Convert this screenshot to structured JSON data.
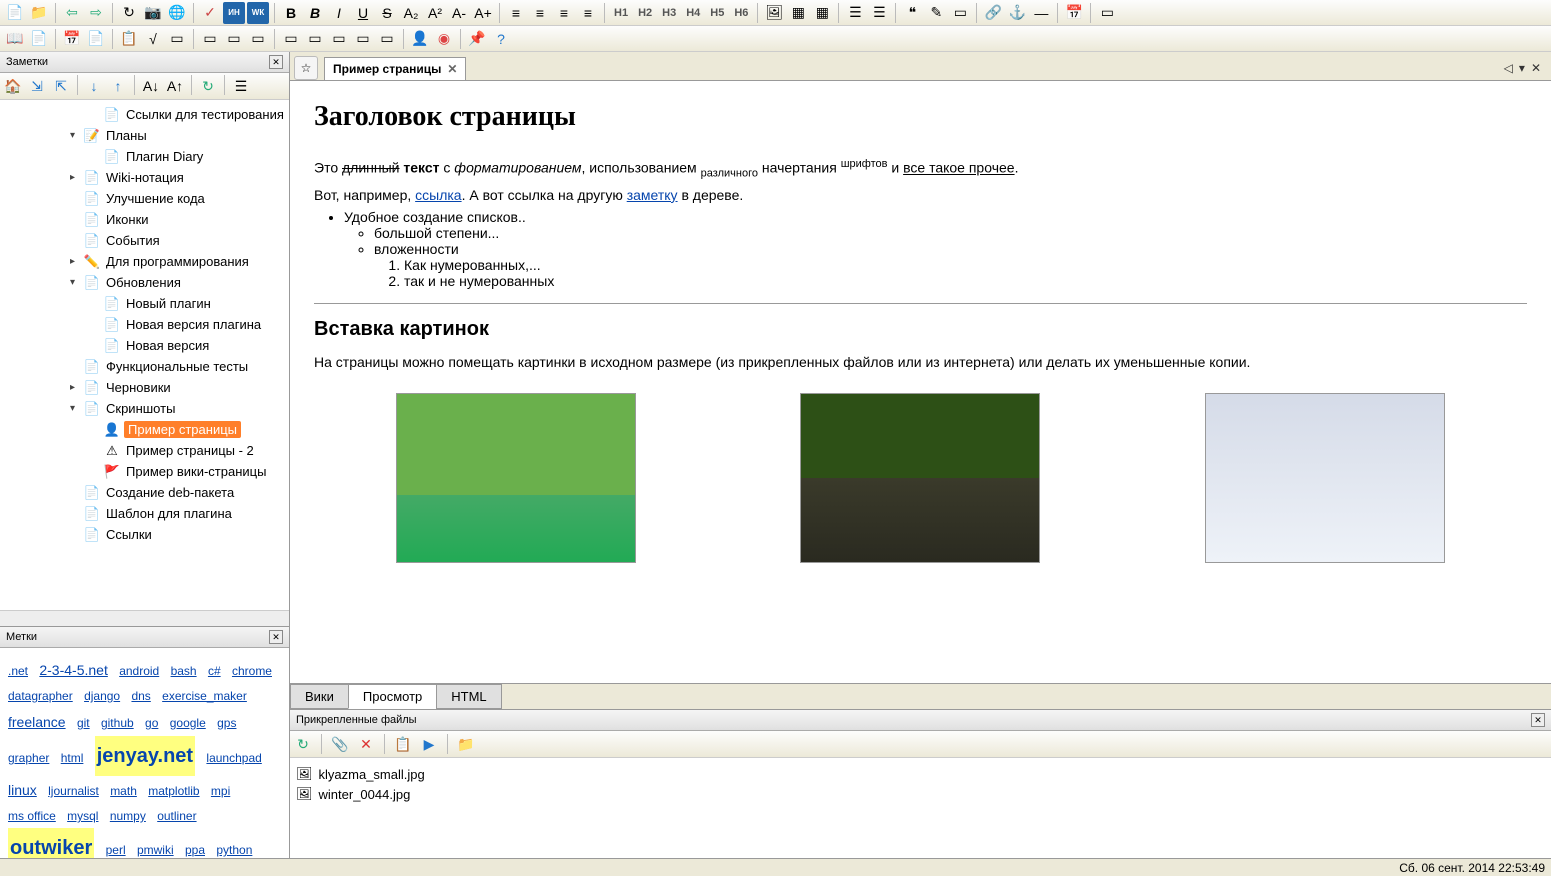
{
  "panels": {
    "notes_title": "Заметки",
    "tags_title": "Метки",
    "attach_title": "Прикрепленные файлы"
  },
  "tree": [
    {
      "label": "Ссылки для тестирования",
      "level": 2,
      "icon": "page"
    },
    {
      "label": "Планы",
      "level": 1,
      "icon": "page-edit",
      "expander": "▾"
    },
    {
      "label": "Плагин Diary",
      "level": 2,
      "icon": "page"
    },
    {
      "label": "Wiki-нотация",
      "level": 1,
      "icon": "page",
      "expander": "▸"
    },
    {
      "label": "Улучшение кода",
      "level": 1,
      "icon": "page"
    },
    {
      "label": "Иконки",
      "level": 1,
      "icon": "page"
    },
    {
      "label": "События",
      "level": 1,
      "icon": "page"
    },
    {
      "label": "Для программирования",
      "level": 1,
      "icon": "pencil",
      "expander": "▸"
    },
    {
      "label": "Обновления",
      "level": 1,
      "icon": "page",
      "expander": "▾"
    },
    {
      "label": "Новый плагин",
      "level": 2,
      "icon": "page"
    },
    {
      "label": "Новая версия плагина",
      "level": 2,
      "icon": "page"
    },
    {
      "label": "Новая версия",
      "level": 2,
      "icon": "page"
    },
    {
      "label": "Функциональные тесты",
      "level": 1,
      "icon": "page"
    },
    {
      "label": "Черновики",
      "level": 1,
      "icon": "page",
      "expander": "▸"
    },
    {
      "label": "Скриншоты",
      "level": 1,
      "icon": "page",
      "expander": "▾"
    },
    {
      "label": "Пример страницы",
      "level": 2,
      "icon": "user",
      "selected": true
    },
    {
      "label": "Пример страницы - 2",
      "level": 2,
      "icon": "warning"
    },
    {
      "label": "Пример вики-страницы",
      "level": 2,
      "icon": "flag"
    },
    {
      "label": "Создание deb-пакета",
      "level": 1,
      "icon": "page"
    },
    {
      "label": "Шаблон для плагина",
      "level": 1,
      "icon": "page"
    },
    {
      "label": "Ссылки",
      "level": 1,
      "icon": "page"
    }
  ],
  "tags": [
    {
      "t": ".net",
      "s": 12
    },
    {
      "t": "2-3-4-5.net",
      "s": 14
    },
    {
      "t": "android",
      "s": 12
    },
    {
      "t": "bash",
      "s": 12
    },
    {
      "t": "c#",
      "s": 12
    },
    {
      "t": "chrome",
      "s": 12
    },
    {
      "t": "datagrapher",
      "s": 12
    },
    {
      "t": "django",
      "s": 12
    },
    {
      "t": "dns",
      "s": 12
    },
    {
      "t": "exercise_maker",
      "s": 12
    },
    {
      "t": "freelance",
      "s": 14
    },
    {
      "t": "git",
      "s": 12
    },
    {
      "t": "github",
      "s": 12
    },
    {
      "t": "go",
      "s": 12
    },
    {
      "t": "google",
      "s": 12
    },
    {
      "t": "gps",
      "s": 12
    },
    {
      "t": "grapher",
      "s": 12
    },
    {
      "t": "html",
      "s": 12
    },
    {
      "t": "jenyay.net",
      "s": 20,
      "hl": true
    },
    {
      "t": "launchpad",
      "s": 12
    },
    {
      "t": "linux",
      "s": 14
    },
    {
      "t": "ljournalist",
      "s": 12
    },
    {
      "t": "math",
      "s": 12
    },
    {
      "t": "matplotlib",
      "s": 12
    },
    {
      "t": "mpi",
      "s": 12
    },
    {
      "t": "ms office",
      "s": 12
    },
    {
      "t": "mysql",
      "s": 12
    },
    {
      "t": "numpy",
      "s": 12
    },
    {
      "t": "outliner",
      "s": 12
    },
    {
      "t": "outwiker",
      "s": 20,
      "hl": true
    },
    {
      "t": "perl",
      "s": 12
    },
    {
      "t": "pmwiki",
      "s": 12
    },
    {
      "t": "ppa",
      "s": 12
    },
    {
      "t": "python",
      "s": 12
    }
  ],
  "tab": {
    "title": "Пример страницы"
  },
  "content": {
    "h1": "Заголовок страницы",
    "p1_parts": {
      "pre": "Это ",
      "strike": "длинный",
      "bold": " текст",
      "mid1": " с ",
      "ital": "форматированием",
      "mid2": ", использованием ",
      "sub": "различного",
      "mid3": " начертания ",
      "sup": "шрифтов",
      "mid4": " и ",
      "u": "все такое прочее",
      "end": "."
    },
    "p2_parts": {
      "pre": "Вот, например, ",
      "link1": "ссылка",
      "mid": ". А вот ссылка на другую ",
      "link2": "заметку",
      "end": " в дереве."
    },
    "list": {
      "li1": "Удобное создание списков..",
      "li2": "большой степени...",
      "li3": "вложенности",
      "ol1": "Как нумерованных,...",
      "ol2": "так и не нумерованных"
    },
    "h2": "Вставка картинок",
    "p3": "На страницы можно помещать картинки в исходном размере (из прикрепленных файлов или из интернета) или делать их уменьшенные копии."
  },
  "view_tabs": {
    "wiki": "Вики",
    "preview": "Просмотр",
    "html": "HTML"
  },
  "headings": {
    "h1": "H1",
    "h2": "H2",
    "h3": "H3",
    "h4": "H4",
    "h5": "H5",
    "h6": "H6"
  },
  "format_btns": {
    "bold": "B",
    "italic_b": "B",
    "italic_i": "I",
    "underline": "U",
    "strike": "S",
    "sub": "A₂",
    "sup": "A²",
    "minus": "A-",
    "plus": "A+"
  },
  "attachments": [
    {
      "name": "klyazma_small.jpg"
    },
    {
      "name": "winter_0044.jpg"
    }
  ],
  "status": "Сб. 06 сент. 2014 22:53:49"
}
